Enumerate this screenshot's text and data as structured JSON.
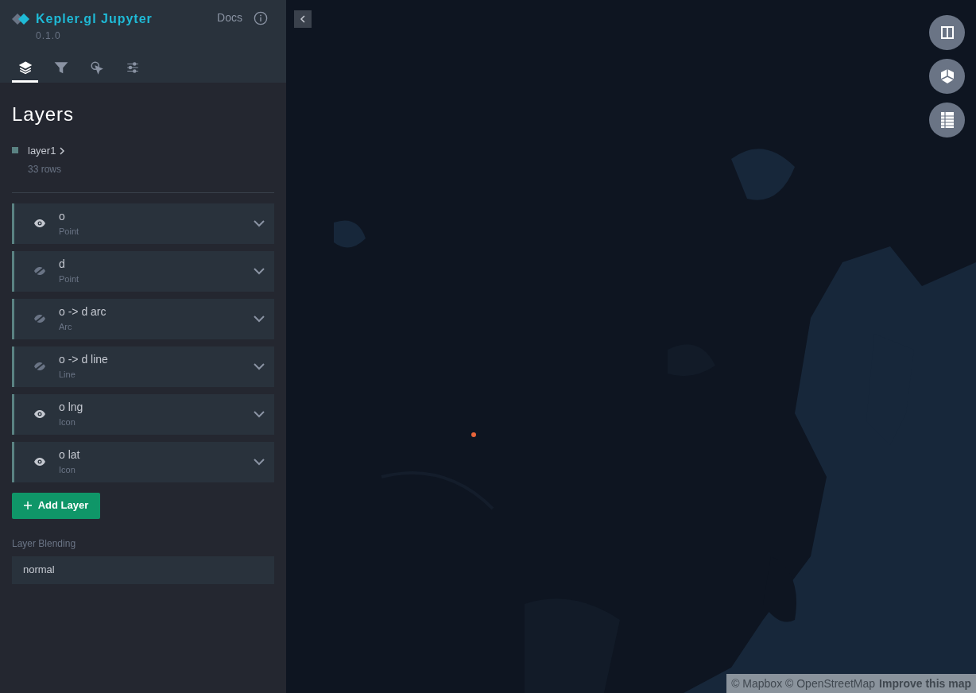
{
  "header": {
    "title": "Kepler.gl Jupyter",
    "version": "0.1.0",
    "docs_link": "Docs"
  },
  "tabs": [
    {
      "kind": "layers",
      "selected": true
    },
    {
      "kind": "filters",
      "selected": false
    },
    {
      "kind": "interactions",
      "selected": false
    },
    {
      "kind": "settings",
      "selected": false
    }
  ],
  "panel_title": "Layers",
  "dataset": {
    "name": "layer1",
    "rows": "33 rows",
    "color": "#5a8282"
  },
  "layers": [
    {
      "name": "o",
      "type": "Point",
      "visible": true
    },
    {
      "name": "d",
      "type": "Point",
      "visible": false
    },
    {
      "name": "o -> d arc",
      "type": "Arc",
      "visible": false
    },
    {
      "name": "o -> d line",
      "type": "Line",
      "visible": false
    },
    {
      "name": "o lng",
      "type": "Icon",
      "visible": true
    },
    {
      "name": "o lat",
      "type": "Icon",
      "visible": true
    }
  ],
  "add_layer_button": "Add Layer",
  "blending": {
    "label": "Layer Blending",
    "value": "normal"
  },
  "map": {
    "attribution": "© Mapbox © OpenStreetMap",
    "improve_link": "Improve this map"
  }
}
